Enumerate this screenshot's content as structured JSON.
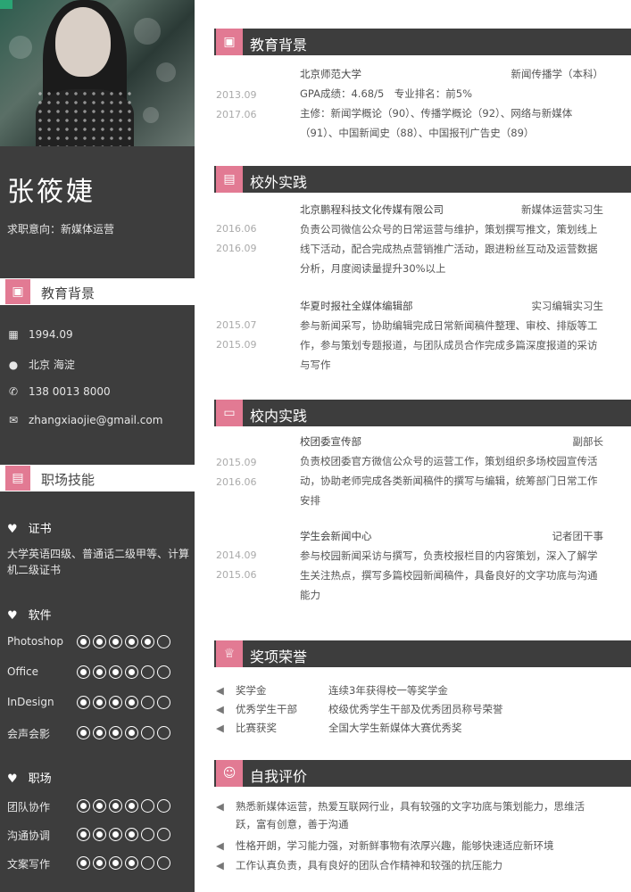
{
  "profile": {
    "name": "张筱婕",
    "objective": "求职意向：新媒体运营"
  },
  "sidebar": {
    "edu_head": "教育背景",
    "contact": {
      "birth": "1994.09",
      "city": "北京 海淀",
      "phone": "138 0013 8000",
      "email": "zhangxiaojie@gmail.com"
    },
    "skills_head": "职场技能",
    "cert_title": "证书",
    "cert_text": "大学英语四级、普通话二级甲等、计算机二级证书",
    "soft_title": "软件",
    "software": [
      {
        "name": "Photoshop",
        "level": 5
      },
      {
        "name": "Office",
        "level": 4
      },
      {
        "name": "InDesign",
        "level": 4
      },
      {
        "name": "会声会影",
        "level": 4
      }
    ],
    "ability_title": "职场",
    "abilities": [
      {
        "name": "团队协作",
        "level": 4
      },
      {
        "name": "沟通协调",
        "level": 4
      },
      {
        "name": "文案写作",
        "level": 4
      }
    ]
  },
  "education": {
    "title": "教育背景",
    "date": [
      "2013.09",
      "2017.06"
    ],
    "school": "北京师范大学",
    "major": "新闻传播学（本科）",
    "gpa": "GPA成绩：4.68/5　专业排名：前5%",
    "courses": "主修：新闻学概论（90）、传播学概论（92）、网络与新媒体（91）、中国新闻史（88）、中国报刊广告史（89）"
  },
  "practice": {
    "title": "校外实践",
    "items": [
      {
        "date": [
          "2016.06",
          "2016.09"
        ],
        "org": "北京鹏程科技文化传媒有限公司",
        "role": "新媒体运营实习生",
        "desc": "负责公司微信公众号的日常运营与维护，策划撰写推文，策划线上线下活动，配合完成热点营销推广活动，跟进粉丝互动及运营数据分析，月度阅读量提升30%以上"
      },
      {
        "date": [
          "2015.07",
          "2015.09"
        ],
        "org": "华夏时报社全媒体编辑部",
        "role": "实习编辑实习生",
        "desc": "参与新闻采写，协助编辑完成日常新闻稿件整理、审校、排版等工作，参与策划专题报道，与团队成员合作完成多篇深度报道的采访与写作"
      }
    ]
  },
  "campus": {
    "title": "校内实践",
    "items": [
      {
        "date": [
          "2015.09",
          "2016.06"
        ],
        "org": "校团委宣传部",
        "role": "副部长",
        "desc": "负责校团委官方微信公众号的运营工作，策划组织多场校园宣传活动，协助老师完成各类新闻稿件的撰写与编辑，统筹部门日常工作安排"
      },
      {
        "date": [
          "2014.09",
          "2015.06"
        ],
        "org": "学生会新闻中心",
        "role": "记者团干事",
        "desc": "参与校园新闻采访与撰写，负责校报栏目的内容策划，深入了解学生关注热点，撰写多篇校园新闻稿件，具备良好的文字功底与沟通能力"
      }
    ]
  },
  "awards": {
    "title": "奖项荣誉",
    "items": [
      {
        "k": "奖学金",
        "v": "连续3年获得校一等奖学金"
      },
      {
        "k": "优秀学生干部",
        "v": "校级优秀学生干部及优秀团员称号荣誉"
      },
      {
        "k": "比赛获奖",
        "v": "全国大学生新媒体大赛优秀奖"
      }
    ]
  },
  "evaluation": {
    "title": "自我评价",
    "items": [
      "熟悉新媒体运营，热爱互联网行业，具有较强的文字功底与策划能力，思维活跃，富有创意，善于沟通",
      "性格开朗，学习能力强，对新鲜事物有浓厚兴趣，能够快速适应新环境",
      "工作认真负责，具有良好的团队合作精神和较强的抗压能力"
    ]
  }
}
